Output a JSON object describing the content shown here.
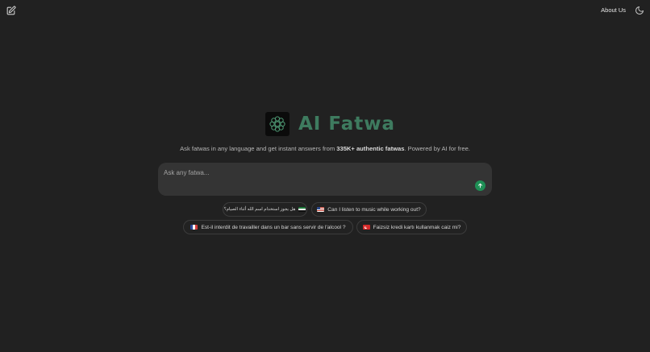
{
  "header": {
    "about_label": "About Us"
  },
  "brand": {
    "name": "AI Fatwa"
  },
  "tagline": {
    "before": "Ask fatwas in any language and get instant answers from ",
    "highlight": "335K+ authentic fatwas",
    "after": ". Powered by AI for free."
  },
  "search": {
    "placeholder": "Ask any fatwa..."
  },
  "suggestions": [
    {
      "text": "هل يجوز استخدام اسم الله أثناء الصيام؟",
      "flag": "arabic-flag"
    },
    {
      "text": "Can I listen to music while working out?",
      "flag": "us-flag"
    },
    {
      "text": "Est-il interdit de travailler dans un bar sans servir de l'alcool ?",
      "flag": "france-flag"
    },
    {
      "text": "Faizsiz kredi kartı kullanmak caiz mi?",
      "flag": "turkey-flag"
    }
  ],
  "colors": {
    "background": "#212121",
    "brand_green": "#3e7b5f",
    "send_button": "#1e8f55",
    "input_bg": "#343434"
  }
}
